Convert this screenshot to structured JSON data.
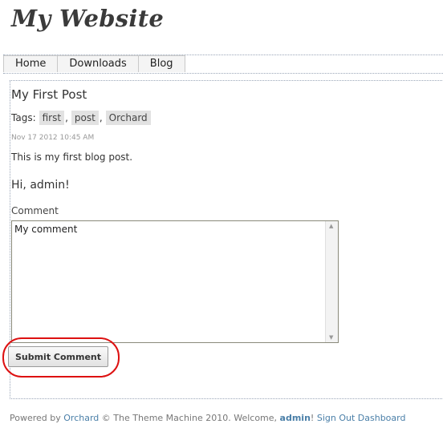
{
  "site": {
    "title": "My Website"
  },
  "nav": {
    "items": [
      {
        "label": "Home"
      },
      {
        "label": "Downloads"
      },
      {
        "label": "Blog"
      }
    ]
  },
  "post": {
    "title": "My First Post",
    "tags_label": "Tags:",
    "tags": [
      "first",
      "post",
      "Orchard"
    ],
    "date": "Nov 17 2012 10:45 AM",
    "body": "This is my first blog post."
  },
  "comment_form": {
    "greeting": "Hi, admin!",
    "label": "Comment",
    "value": "My comment",
    "submit_label": "Submit Comment"
  },
  "footer": {
    "powered_by": "Powered by",
    "orchard_link": "Orchard",
    "copyright": "© The Theme Machine 2010.",
    "welcome": "Welcome,",
    "user": "admin",
    "excl": "!",
    "sign_out": "Sign Out",
    "dashboard": "Dashboard"
  },
  "colors": {
    "link": "#4a7fa8",
    "highlight": "#dd1111"
  }
}
